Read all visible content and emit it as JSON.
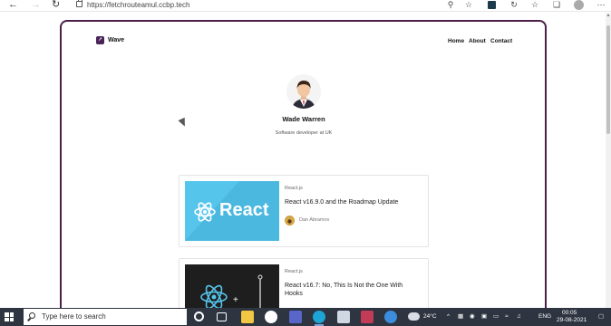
{
  "browser": {
    "url": "https://fetchrouteamul.ccbp.tech",
    "back_icon": "arrow-left",
    "forward_icon": "arrow-right",
    "refresh_icon": "refresh"
  },
  "site": {
    "logo_text": "Wave",
    "nav": [
      "Home",
      "About",
      "Contact"
    ]
  },
  "profile": {
    "name": "Wade Warren",
    "role": "Software developer at UK"
  },
  "posts": [
    {
      "tag": "React.js",
      "title": "React v16.9.0 and the Roadmap Update",
      "author": "Dan Abramov",
      "thumb_text": "React"
    },
    {
      "tag": "React.js",
      "title": "React v16.7: No, This Is Not the One With Hooks",
      "author": "",
      "thumb_text": ""
    }
  ],
  "taskbar": {
    "search_placeholder": "Type here to search",
    "temperature": "24°C",
    "language": "ENG",
    "time": "00:05",
    "date": "29-08-2021"
  },
  "colors": {
    "frame": "#4a1f4a",
    "react_blue": "#55c5ec",
    "taskbar": "#2e3440"
  }
}
